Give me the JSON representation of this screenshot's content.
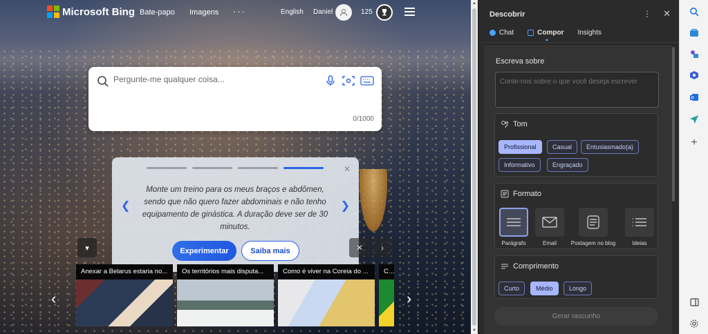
{
  "bing": {
    "logo_text": "Microsoft Bing",
    "nav": {
      "chat": "Bate-papo",
      "images": "Imagens",
      "more": "···"
    },
    "language": "English",
    "user": "Daniel",
    "points": "125",
    "search": {
      "placeholder": "Pergunte-me qualquer coisa...",
      "counter": "0/1000"
    },
    "card": {
      "text": "Monte um treino para os meus braços e abdômen, sendo que não quero fazer abdominais e não tenho equipamento de ginástica. A duração deve ser de 30 minutos.",
      "try_label": "Experimentar",
      "more_label": "Saiba mais",
      "close": "✕"
    },
    "news": [
      {
        "title": "Anexar a Belarus estaria no..."
      },
      {
        "title": "Os territórios mais disputa..."
      },
      {
        "title": "Como é viver na Coreia do ..."
      },
      {
        "title": "Cer"
      }
    ]
  },
  "panel": {
    "title": "Descobrir",
    "tabs": [
      {
        "label": "Chat",
        "icon": "chat-icon",
        "color": "#4aa3ff"
      },
      {
        "label": "Compor",
        "icon": "compose-icon",
        "color": "#4aa3ff"
      },
      {
        "label": "Insights",
        "icon": "",
        "color": ""
      }
    ],
    "write_about": {
      "label": "Escreva sobre",
      "placeholder": "Conte-nos sobre o que você deseja escrever"
    },
    "tone": {
      "label": "Tom",
      "options": [
        "Profissional",
        "Casual",
        "Entusiasmado(a)",
        "Informativo",
        "Engraçado"
      ],
      "selected": "Profissional"
    },
    "format": {
      "label": "Formato",
      "options": [
        "Parágrafo",
        "Email",
        "Postagem no blog",
        "Ideias"
      ],
      "selected": "Parágrafo"
    },
    "length": {
      "label": "Comprimento",
      "options": [
        "Curto",
        "Médio",
        "Longo"
      ],
      "selected": "Médio"
    },
    "draft_button": "Gerar rascunho"
  },
  "colors": {
    "accent": "#2b63e8",
    "pill_selected": "#a8b6ff"
  }
}
